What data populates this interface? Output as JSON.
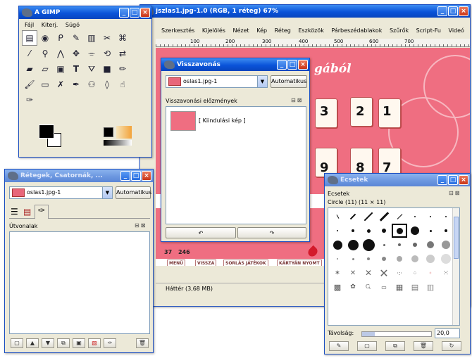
{
  "toolbox": {
    "title": "A GIMP",
    "menu": [
      "Fájl",
      "Kiterj.",
      "Súgó"
    ],
    "tools": [
      "rect-select",
      "ellipse-select",
      "lasso",
      "fuzzy-select",
      "color-select",
      "scissors",
      "path",
      "color-picker",
      "zoom",
      "measure",
      "move",
      "crop",
      "transform",
      "flip",
      "text",
      "bucket",
      "blend",
      "pencil",
      "paintbrush",
      "eraser",
      "airbrush",
      "ink",
      "clone",
      "convolve",
      "dodge",
      "smudge",
      "extra",
      "extra2",
      "ink-pen"
    ]
  },
  "image_window": {
    "title": "jszlas1.jpg-1.0 (RGB, 1 réteg) 67%",
    "menu": [
      "Szerkesztés",
      "Kijelölés",
      "Nézet",
      "Kép",
      "Réteg",
      "Eszközök",
      "Párbeszédablakok",
      "Szűrők",
      "Script-Fu",
      "Videó"
    ],
    "ruler_ticks": [
      "100",
      "200",
      "300",
      "400",
      "500",
      "600",
      "700"
    ],
    "canvas_heading": "gából",
    "cards_top": [
      "3",
      "2",
      "1"
    ],
    "cards_bottom": [
      "9",
      "8",
      "7"
    ],
    "counter_left": "37",
    "counter_right": "246",
    "nav_tabs": [
      "MENÜ",
      "VISSZA",
      "SORLÁS JÁTÉKOK",
      "KÁRTYÁN NYOMT"
    ],
    "status": "Háttér (3,68 MB)"
  },
  "undo_dialog": {
    "title": "Visszavonás",
    "combo_value": "oslas1.jpg-1",
    "auto_button": "Automatikus",
    "panel_title": "Visszavonási előzmények",
    "history_item": "[ Kiindulási kép ]"
  },
  "layers_dialog": {
    "title": "Rétegek, Csatornák, ...",
    "combo_value": "oslas1.jpg-1",
    "auto_button": "Automatikus",
    "panel_title": "Útvonalak"
  },
  "brushes_dialog": {
    "title": "Ecsetek",
    "panel_title": "Ecsetek",
    "selected_brush": "Circle (11) (11 × 11)",
    "spacing_label": "Távolság:",
    "spacing_value": "20,0"
  },
  "colors": {
    "accent": "#0a53d9",
    "canvas_pink": "#ef6e81"
  }
}
